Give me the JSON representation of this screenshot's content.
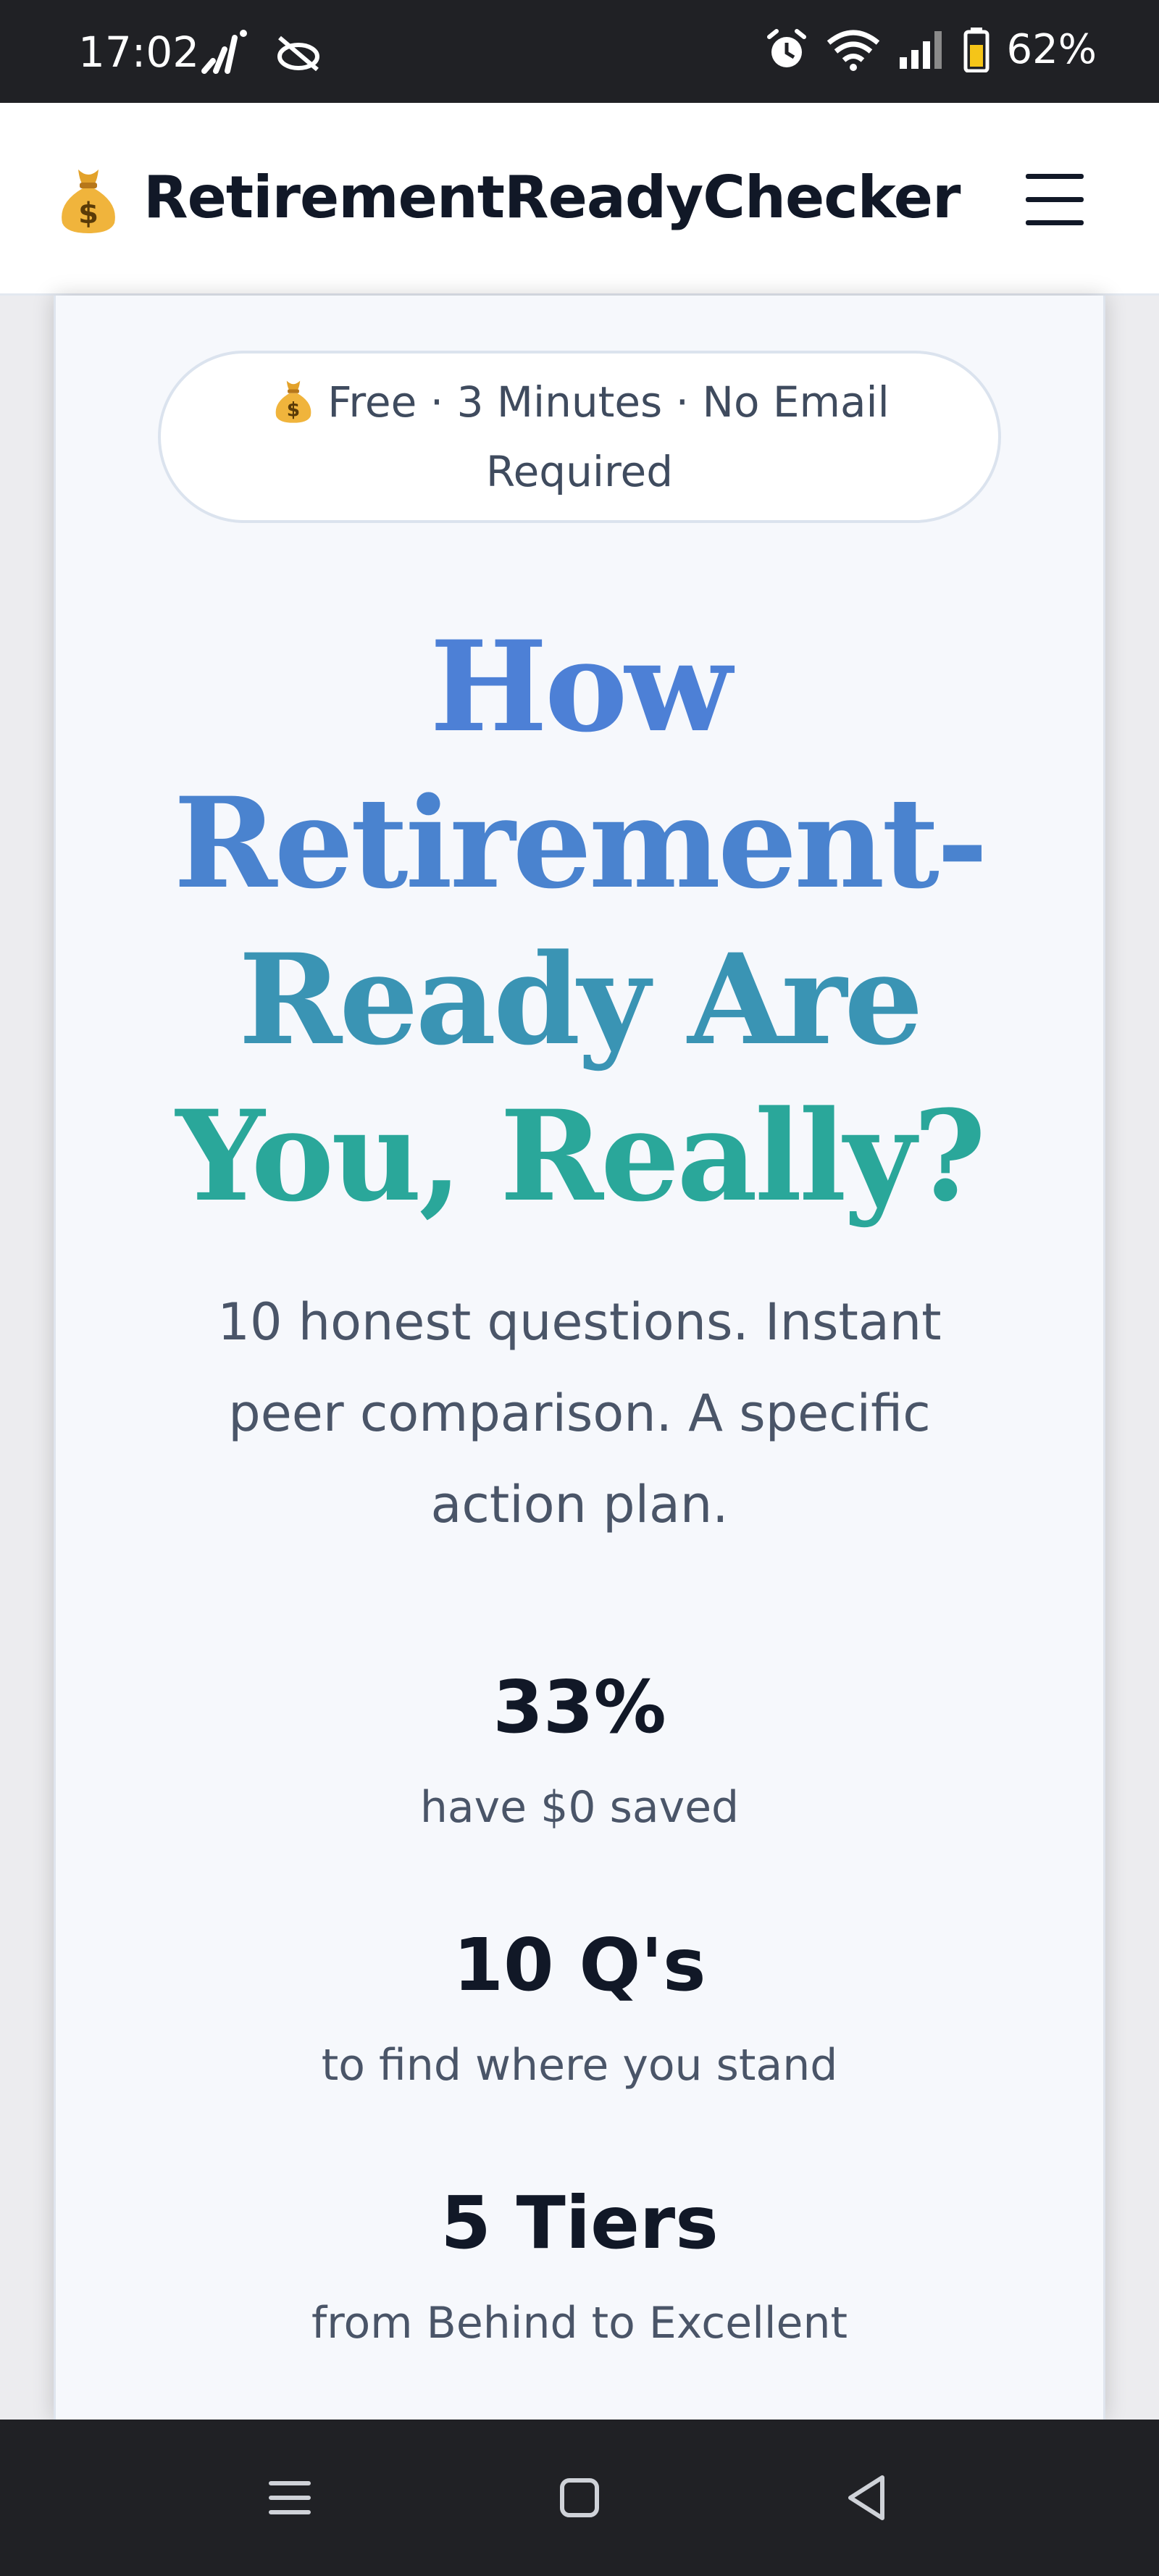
{
  "status_bar": {
    "time": "17:02",
    "battery_percent": "62%"
  },
  "header": {
    "brand": "RetirementReadyChecker"
  },
  "hero": {
    "badge": "Free · 3 Minutes · No Email Required",
    "title_lines": [
      "How",
      "Retirement-",
      "Ready Are",
      "You, Really?"
    ],
    "subtitle": "10 honest questions. Instant peer comparison. A specific action plan."
  },
  "stats": [
    {
      "value": "33%",
      "label": "have $0 saved"
    },
    {
      "value": "10 Q's",
      "label": "to find where you stand"
    },
    {
      "value": "5 Tiers",
      "label": "from Behind to Excellent"
    }
  ],
  "colors": {
    "title_gradient_start": "#4d80d6",
    "title_gradient_end": "#2aa79a",
    "text_dark": "#111827",
    "text_muted": "#4a5568"
  }
}
